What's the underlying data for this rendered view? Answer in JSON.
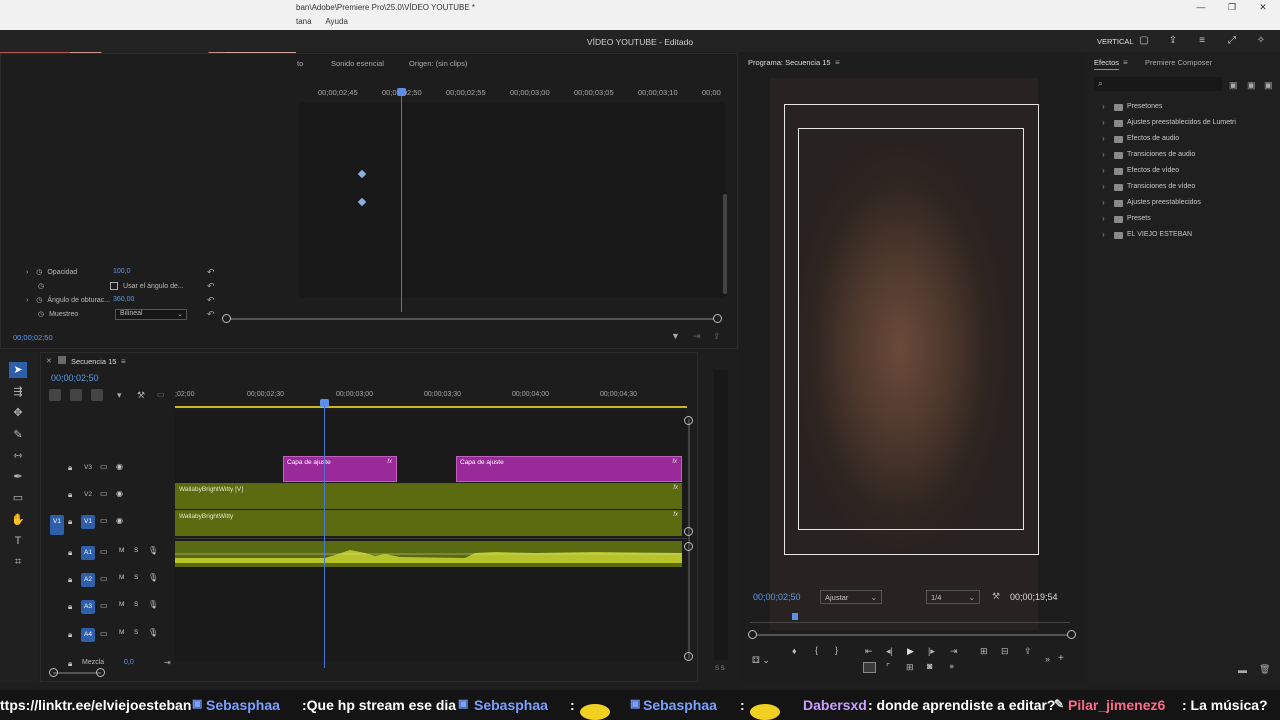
{
  "window": {
    "path": "ban\\Adobe\\Premiere Pro\\25.0\\VÍDEO YOUTUBE *",
    "menu": [
      "tana",
      "Ayuda"
    ],
    "project_title": "VÍDEO YOUTUBE - Editado",
    "workspace": "VERTICAL"
  },
  "effect_controls": {
    "tabs": [
      "to",
      "Sonido esencial",
      "Origen: (sin clips)"
    ],
    "ruler": [
      "00;00;02;45",
      "00;00;02;50",
      "00;00;02;55",
      "00;00;03;00",
      "00;00;03;05",
      "00;00;03;10",
      "00;00"
    ],
    "properties": [
      {
        "name": "Opacidad",
        "value": "100,0"
      },
      {
        "name": "Usar el ángulo de..."
      },
      {
        "name": "Ángulo de obturac...",
        "value": "360,00"
      },
      {
        "name": "Muestreo",
        "value": "Bilineal"
      }
    ],
    "timecode": "00;00;02;50"
  },
  "program_monitor": {
    "title": "Programa: Secuencia 15",
    "timecode": "00;00;02;50",
    "fit": "Ajustar",
    "resolution": "1/4",
    "duration": "00;00;19;54"
  },
  "effects_panel": {
    "tabs": [
      "Efectos",
      "Premiere Composer"
    ],
    "items": [
      "Presetones",
      "Ajustes preestablecidos de Lumetri",
      "Efectos de audio",
      "Transiciones de audio",
      "Efectos de vídeo",
      "Transiciones de vídeo",
      "Ajustes preestablecidos",
      "Presets",
      "EL VIEJO ESTEBAN"
    ]
  },
  "timeline": {
    "sequence": "Secuencia 15",
    "timecode": "00;00;02;50",
    "ruler": [
      ";02;00",
      "00;00;02;30",
      "00;00;03;00",
      "00;00;03;30",
      "00;00;04;00",
      "00;00;04;30"
    ],
    "tracks": {
      "video": [
        "V3",
        "V2",
        "V1"
      ],
      "audio": [
        "A1",
        "A2",
        "A3",
        "A4"
      ],
      "source_patch": "V1"
    },
    "clips": {
      "adj1": "Capa de ajuste",
      "adj2": "Capa de ajuste",
      "v2": "WallabyBrightWitty [V]",
      "v1": "WallabyBrightWitty",
      "fx": "fx"
    },
    "mix_label": "Mezcla",
    "mix_value": "0,0",
    "meter_labels": "S S"
  },
  "chat": {
    "m1": "ttps://linktr.ee/elviejoesteban",
    "u2": "Sebasphaa",
    "m2": ":Que hp stream ese dia",
    "u3": "Sebasphaa",
    "m3": ":",
    "u4": "Sebasphaa",
    "m4": ":",
    "u5": "Dabersxd",
    "m5": ": donde aprendiste a editar?",
    "u6": "Pilar_jimenez6",
    "m6": ": La música?"
  }
}
